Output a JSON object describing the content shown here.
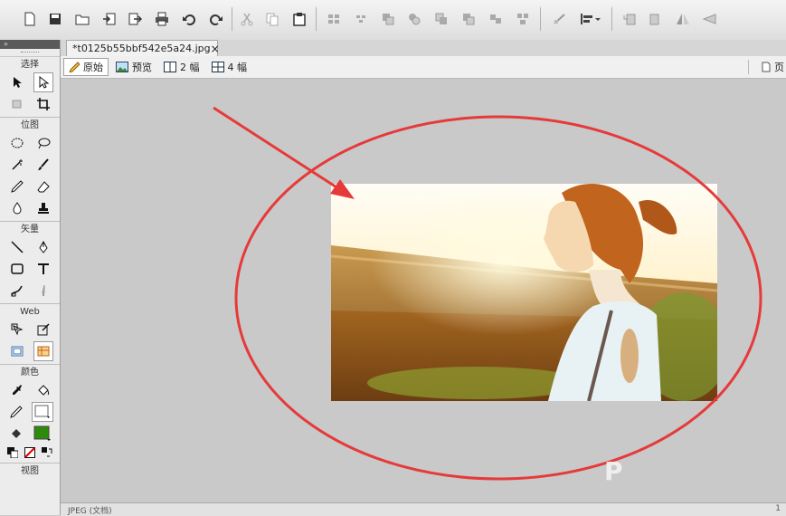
{
  "document": {
    "tab_title": "*t0125b55bbf542e5a24.jpg",
    "close_glyph": "×"
  },
  "view_modes": [
    "原始",
    "预览",
    "2 幅",
    "4 幅"
  ],
  "right_panel_label": "页",
  "tools_panel": {
    "sections": [
      "选择",
      "位图",
      "矢量",
      "Web",
      "颜色",
      "视图"
    ]
  },
  "fill_color": "#2e8a0c",
  "annotation_color": "#e63a3a",
  "watermark": "P",
  "status_text": "JPEG (文档)",
  "status_right": "1"
}
